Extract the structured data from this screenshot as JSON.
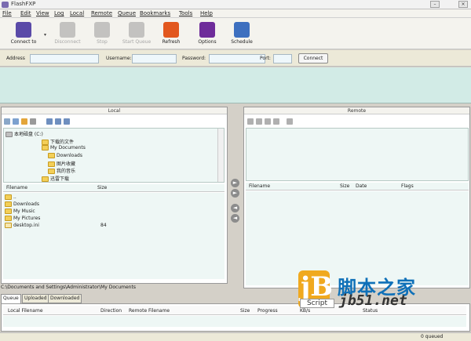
{
  "window": {
    "title": "FlashFXP",
    "minimize": "–",
    "close": "×"
  },
  "menu": [
    "File",
    "Edit",
    "View",
    "Log",
    "Local",
    "Remote",
    "Queue",
    "Bookmarks",
    "Tools",
    "Help"
  ],
  "toolbar": [
    {
      "label": "Connect to",
      "enabled": true,
      "icon": "connect-icon",
      "color": "#5a4aa8"
    },
    {
      "label": "Disconnect",
      "enabled": false,
      "icon": "disconnect-icon",
      "color": "#888888"
    },
    {
      "label": "Stop",
      "enabled": false,
      "icon": "stop-icon",
      "color": "#888888"
    },
    {
      "label": "Start Queue",
      "enabled": false,
      "icon": "play-icon",
      "color": "#888888"
    },
    {
      "label": "Refresh",
      "enabled": true,
      "icon": "refresh-icon",
      "color": "#e2571e"
    },
    {
      "label": "Options",
      "enabled": true,
      "icon": "options-icon",
      "color": "#6e2c9a"
    },
    {
      "label": "Schedule",
      "enabled": true,
      "icon": "schedule-icon",
      "color": "#3d6fbf"
    }
  ],
  "connect": {
    "address_label": "Address",
    "username_label": "Username:",
    "password_label": "Password:",
    "port_label": "Port:",
    "button": "Connect"
  },
  "local": {
    "title": "Local",
    "drive": "本地磁盘 (C:)",
    "tree": [
      "下载的文件",
      "My Documents",
      "Downloads",
      "图片收藏",
      "我的音乐",
      "迅雷下载"
    ],
    "columns": {
      "filename": "Filename",
      "size": "Size"
    },
    "files": [
      {
        "name": "..",
        "size": ""
      },
      {
        "name": "Downloads",
        "size": ""
      },
      {
        "name": "My Music",
        "size": ""
      },
      {
        "name": "My Pictures",
        "size": ""
      },
      {
        "name": "desktop.ini",
        "size": "84"
      }
    ],
    "path": "C:\\Documents and Settings\\Administrator\\My Documents"
  },
  "remote": {
    "title": "Remote",
    "columns": {
      "filename": "Filename",
      "size": "Size",
      "date": "Date",
      "flags": "Flags"
    }
  },
  "tabs": [
    "Queue",
    "Uploaded",
    "Downloaded"
  ],
  "queue": {
    "columns": [
      "Local Filename",
      "Direction",
      "Remote Filename",
      "Size",
      "Progress",
      "KB/s",
      "Status"
    ]
  },
  "status": {
    "queued": "0 queued"
  },
  "watermark": {
    "logo": "jB",
    "script": "Script",
    "cn": "脚本之家",
    "url": "jb51.net"
  }
}
